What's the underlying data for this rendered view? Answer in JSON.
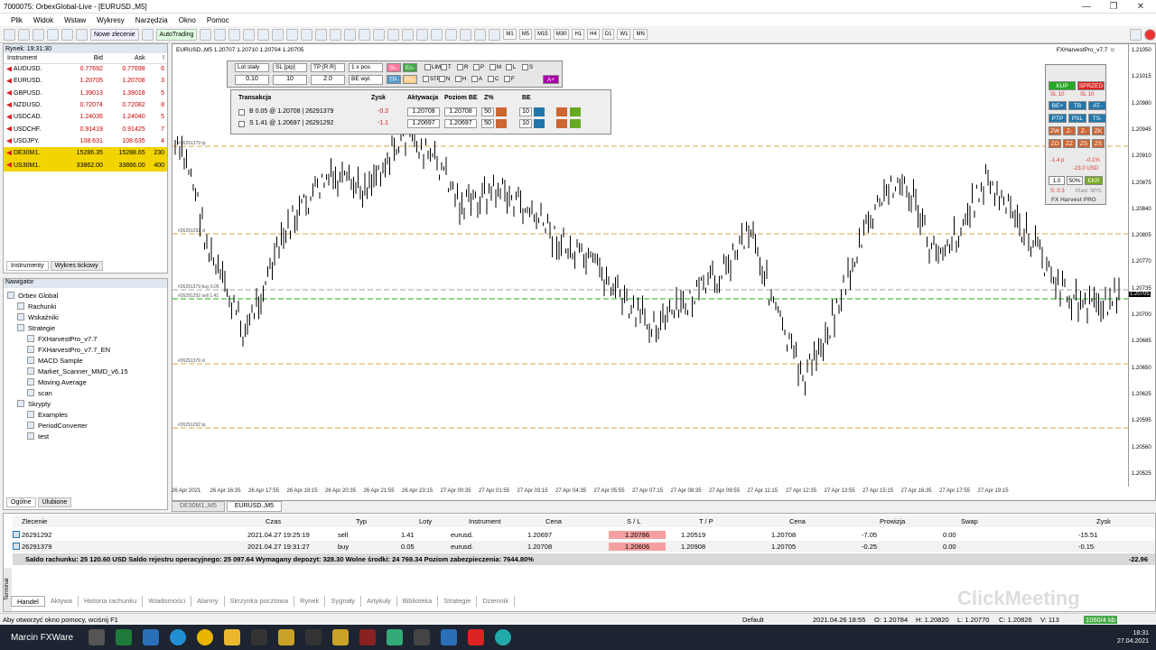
{
  "window": {
    "title": "7000075: OrbexGlobal-Live - [EURUSD.,M5]"
  },
  "menu": [
    "Plik",
    "Widok",
    "Wstaw",
    "Wykresy",
    "Narzędzia",
    "Okno",
    "Pomoc"
  ],
  "toolbar": {
    "new_order": "Nowe zlecenie",
    "autotrading": "AutoTrading",
    "timeframes": [
      "M1",
      "M5",
      "M15",
      "M30",
      "H1",
      "H4",
      "D1",
      "W1",
      "MN"
    ]
  },
  "market_watch": {
    "header": "Rynek: 19:31:30",
    "columns": [
      "Instrument",
      "Bid",
      "Ask",
      "!"
    ],
    "rows": [
      [
        "AUDUSD.",
        "0.77692",
        "0.77698",
        "6"
      ],
      [
        "EURUSD.",
        "1.20705",
        "1.20708",
        "3"
      ],
      [
        "GBPUSD.",
        "1.39013",
        "1.39018",
        "5"
      ],
      [
        "NZDUSD.",
        "0.72074",
        "0.72082",
        "8"
      ],
      [
        "USDCAD.",
        "1.24035",
        "1.24040",
        "5"
      ],
      [
        "USDCHF.",
        "0.91419",
        "0.91425",
        "7"
      ],
      [
        "USDJPY.",
        "108.631",
        "108.635",
        "4"
      ],
      [
        "DE30M1.",
        "15286.35",
        "15288.65",
        "230"
      ],
      [
        "US30M1.",
        "33862.00",
        "33866.00",
        "400"
      ]
    ],
    "tabs": [
      "Instrumenty",
      "Wykres tickowy"
    ]
  },
  "navigator": {
    "header": "Nawigator",
    "items": [
      "Orbex Global",
      "Rachunki",
      "Wskaźniki",
      "Strategie",
      "FXHarvestPro_v7.7",
      "FXHarvestPro_v7.7_EN",
      "MACD Sample",
      "Market_Scanner_MMD_v6.15",
      "Moving Average",
      "scan",
      "Skrypty",
      "Examples",
      "PeriodConverter",
      "test"
    ],
    "tabs": [
      "Ogólne",
      "Ulubione"
    ]
  },
  "chart": {
    "info": "EURUSD.,M5  1.20707 1.20710 1.20704 1.20705",
    "ea": "FXHarvestPro_v7.7 ☺",
    "price_labels": [
      "1.21050",
      "1.21015",
      "1.20980",
      "1.20945",
      "1.20910",
      "1.20875",
      "1.20840",
      "1.20805",
      "1.20770",
      "1.20735",
      "1.20700",
      "1.20685",
      "1.20650",
      "1.20625",
      "1.20595",
      "1.20560",
      "1.20525"
    ],
    "current_price": "1.20705",
    "lines": [
      "#26291379 tp",
      "#26291292 sl",
      "#26291379 buy 0.05",
      "#26291292 sell 1.41",
      "#26291379 sl",
      "#26291292 tp"
    ],
    "x_labels": [
      "26 Apr 2021",
      "26 Apr 16:35",
      "26 Apr 17:55",
      "26 Apr 19:15",
      "26 Apr 20:35",
      "26 Apr 21:55",
      "26 Apr 23:15",
      "27 Apr 00:35",
      "27 Apr 01:55",
      "27 Apr 03:15",
      "27 Apr 04:35",
      "27 Apr 05:55",
      "27 Apr 07:15",
      "27 Apr 08:35",
      "27 Apr 09:55",
      "27 Apr 11:15",
      "27 Apr 12:35",
      "27 Apr 13:55",
      "27 Apr 15:15",
      "27 Apr 16:35",
      "27 Apr 17:55",
      "27 Apr 19:15"
    ],
    "tabs": [
      "DE30M1.,M5",
      "EURUSD.,M5"
    ]
  },
  "ea_panel": {
    "lot_label": "Lot stały",
    "sl_label": "SL [pip]",
    "tp_label": "TP [R:R]",
    "pos_label": "1 x pos",
    "lot": "0.10",
    "sl": "10",
    "tp": "2.0",
    "be_label": "BE wył.",
    "flags": [
      "LIM",
      "T",
      "R",
      "P",
      "M",
      "L",
      "S",
      "STP",
      "N",
      "H",
      "A",
      "C",
      "F"
    ],
    "sl_btn": "SL-",
    "en_btn": "En-",
    "tp_btn": "TP-",
    "ps_btn": "PS-",
    "a_btn": "A+",
    "columns": [
      "Transakcja",
      "Zysk",
      "Aktywacja",
      "Poziom BE",
      "Z%",
      "BE"
    ],
    "trades": [
      {
        "desc": "B 0.05 @ 1.20708 | 26291379",
        "profit": "-0.3",
        "act": "1.20708",
        "be": "1.20708",
        "z": "50",
        "bev": "10"
      },
      {
        "desc": "S 1.41 @ 1.20697 | 26291292",
        "profit": "-1.1",
        "act": "1.20697",
        "be": "1.20697",
        "z": "50",
        "bev": "10"
      }
    ]
  },
  "side_panel": {
    "kup": "KUP",
    "sprzed": "SPRZED",
    "sl1": "SL 10",
    "sl2": "SL 10",
    "r1": [
      "BE+",
      "TB",
      "AT-"
    ],
    "r2": [
      "PTP",
      "PSL",
      "TS-"
    ],
    "r3": [
      "ZW",
      "Z-",
      "Z-",
      "ZK"
    ],
    "r4": [
      "ZO",
      "ZZ",
      "ZS",
      "ZS"
    ],
    "pips": "-1.4 p",
    "pct": "-0.1%",
    "usd": "-23.0 USD",
    "v1": "1.0",
    "v2": "50%",
    "ekr": "EKR",
    "s": "S: 0.3",
    "klaw": "Klaw: WYŁ",
    "brand": "FX Harvest PRO"
  },
  "orders": {
    "columns": [
      "Zlecenie",
      "Czas",
      "Typ",
      "Loty",
      "Instrument",
      "Cena",
      "S / L",
      "T / P",
      "Cena",
      "Prowizja",
      "Swap",
      "Zysk"
    ],
    "rows": [
      [
        "26291292",
        "2021.04.27 19:25:19",
        "sell",
        "1.41",
        "eurusd.",
        "1.20697",
        "1.20786",
        "1.20519",
        "1.20708",
        "-7.05",
        "0.00",
        "-15.51"
      ],
      [
        "26291379",
        "2021.04.27 19:31:27",
        "buy",
        "0.05",
        "eurusd.",
        "1.20708",
        "1.20606",
        "1.20908",
        "1.20705",
        "-0.25",
        "0.00",
        "-0.15"
      ]
    ],
    "balance": "Saldo rachunku: 25 120.60 USD  Saldo rejestru operacyjnego: 25 097.64  Wymagany depozyt: 328.30  Wolne środki: 24 769.34  Poziom zabezpieczenia: 7644.80%",
    "total": "-22.96"
  },
  "terminal_tabs": [
    "Handel",
    "Aktywa",
    "Historia rachunku",
    "Wiadomości",
    "Alarmy",
    "Skrzynka pocztowa",
    "Rynek",
    "Sygnały",
    "Artykuły",
    "Biblioteka",
    "Strategie",
    "Dziennik"
  ],
  "terminal_label": "Terminal",
  "status": {
    "help": "Aby otworzyć okno pomocy, wciśnij F1",
    "profile": "Default",
    "time": "2021.04.26 18:55",
    "o": "O: 1.20784",
    "h": "H: 1.20820",
    "l": "L: 1.20770",
    "c": "C: 1.20826",
    "v": "V: 113",
    "kb": "1060/4 kb"
  },
  "taskbar": {
    "user": "Marcin FXWare",
    "time": "18:31",
    "date": "27.04.2021"
  },
  "watermark": "ClickMeeting"
}
